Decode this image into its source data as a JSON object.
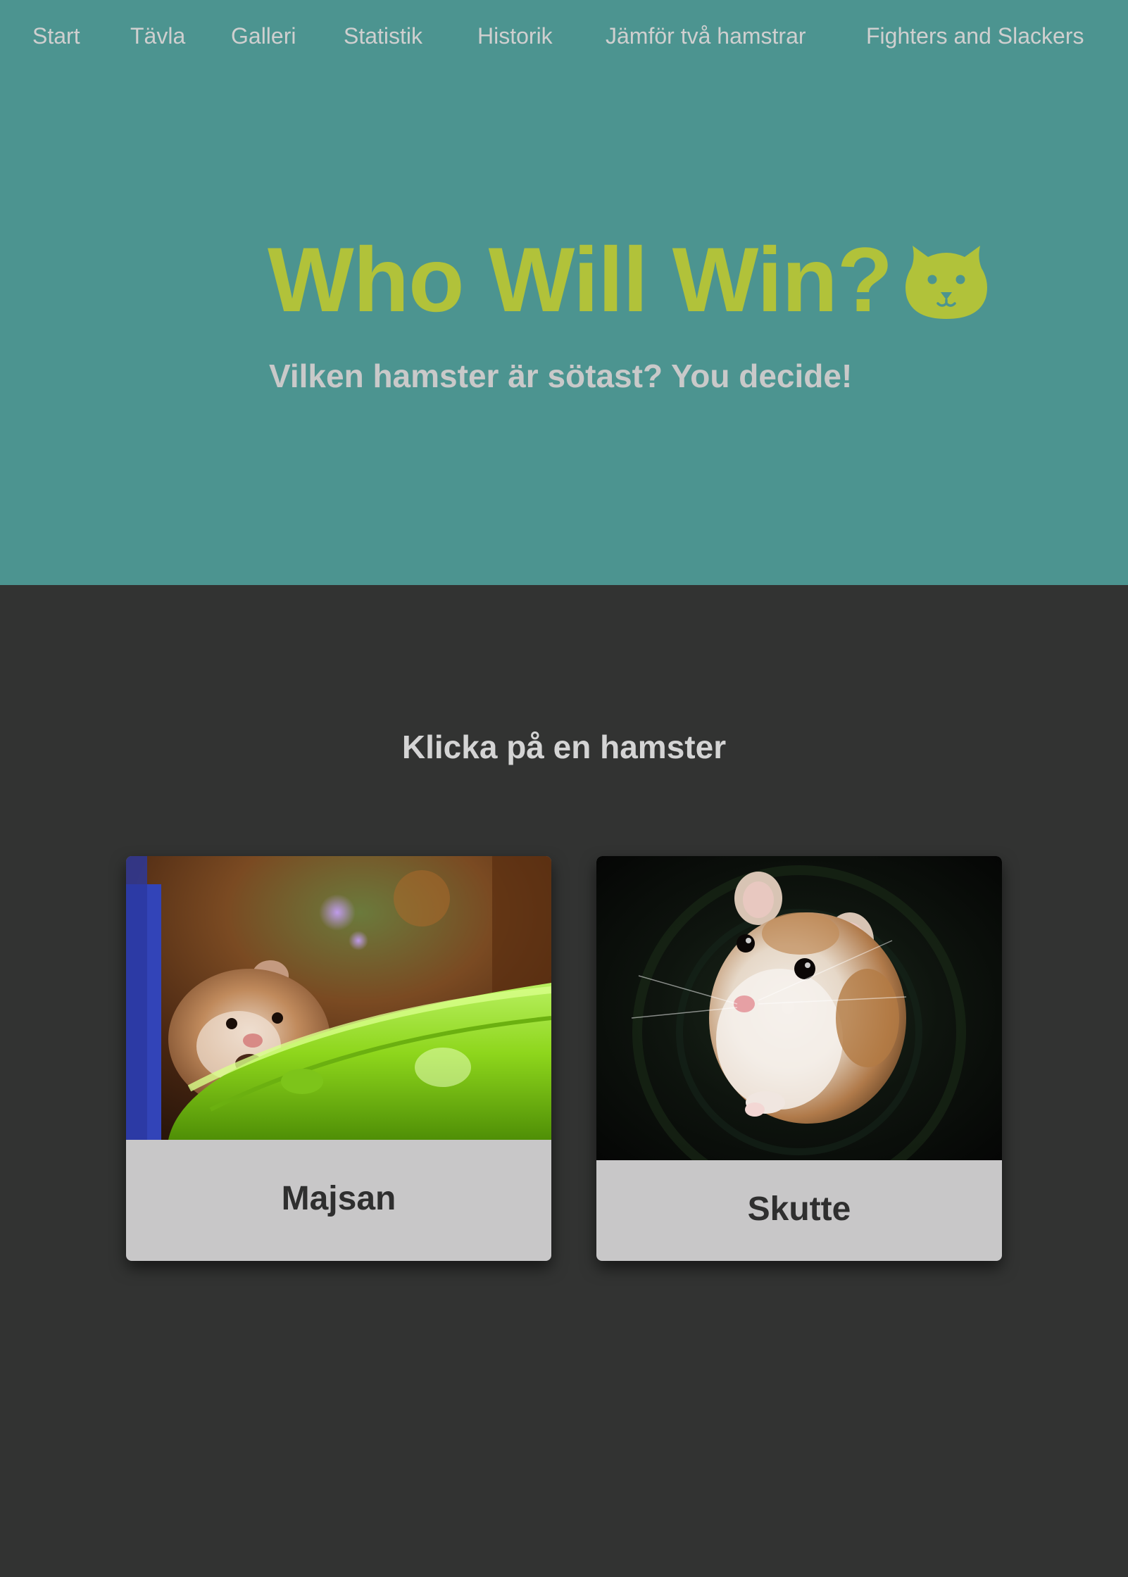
{
  "nav": {
    "items": [
      {
        "label": "Start"
      },
      {
        "label": "Tävla"
      },
      {
        "label": "Galleri"
      },
      {
        "label": "Statistik"
      },
      {
        "label": "Historik"
      },
      {
        "label": "Jämför två hamstrar"
      },
      {
        "label": "Fighters and Slackers"
      }
    ]
  },
  "hero": {
    "title": "Who Will Win?",
    "logo_icon": "hamster-face-icon",
    "subtitle": "Vilken hamster är sötast? You decide!"
  },
  "main": {
    "prompt": "Klicka på en hamster",
    "hamsters": [
      {
        "name": "Majsan"
      },
      {
        "name": "Skutte"
      }
    ]
  },
  "colors": {
    "hero_background": "#4c9490",
    "page_background": "#323332",
    "accent": "#b1c23a",
    "card_background": "#c8c7c8"
  }
}
